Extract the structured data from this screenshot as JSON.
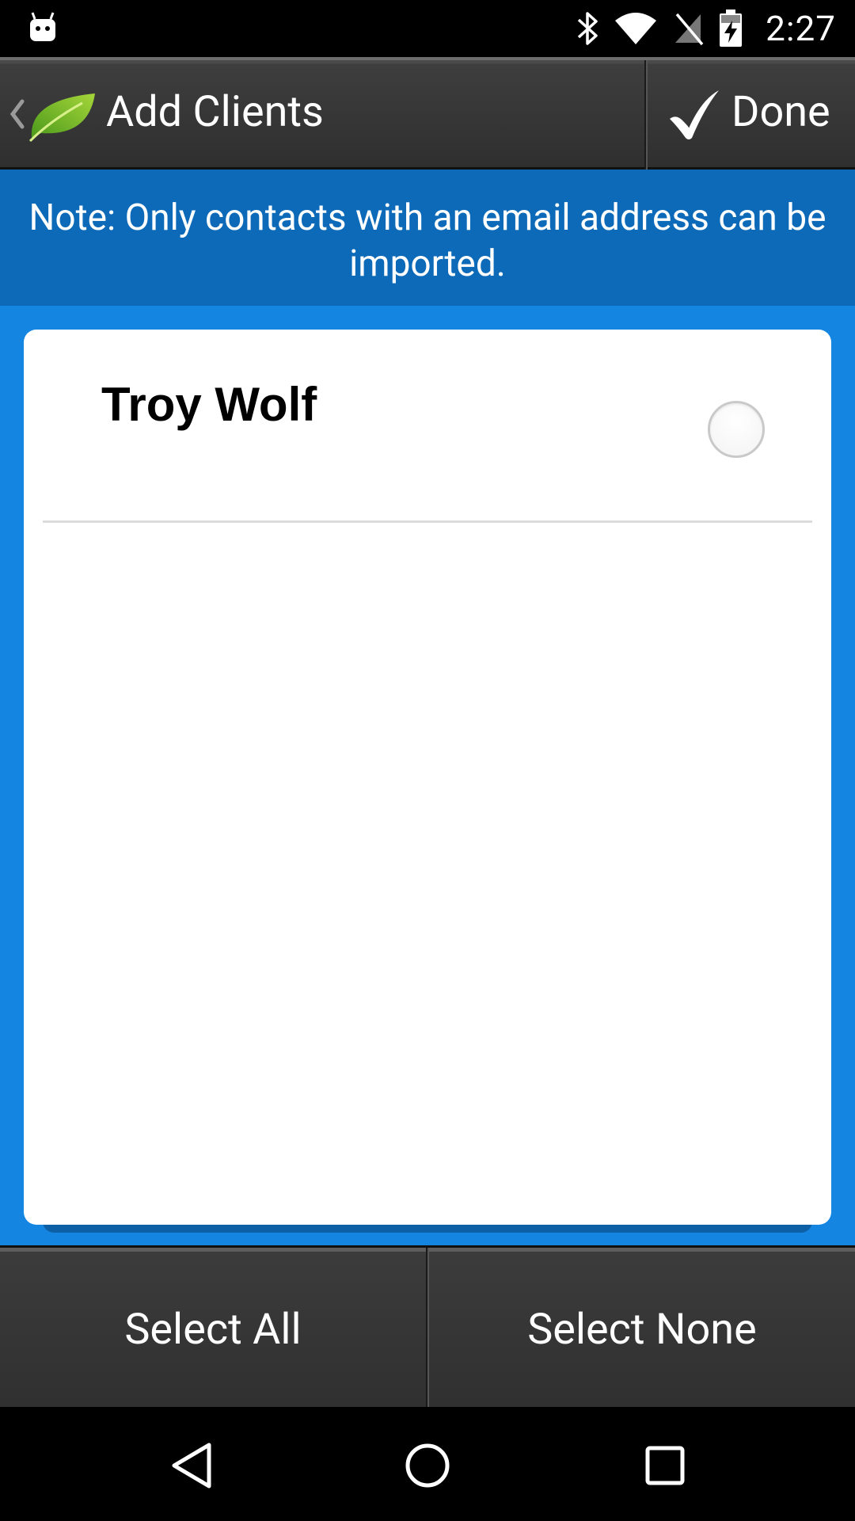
{
  "status_bar": {
    "time": "2:27",
    "icons": [
      "android-debug-icon",
      "bluetooth-icon",
      "wifi-icon",
      "no-sim-icon",
      "battery-charging-icon"
    ]
  },
  "action_bar": {
    "title": "Add Clients",
    "done_label": "Done",
    "icons": [
      "chevron-left-icon",
      "leaf-logo-icon",
      "checkmark-icon"
    ]
  },
  "note": {
    "text": "Note: Only contacts with an email address can be imported."
  },
  "contacts": [
    {
      "name": "Troy Wolf",
      "selected": false
    }
  ],
  "bottom_bar": {
    "select_all_label": "Select All",
    "select_none_label": "Select None"
  },
  "nav_bar": {
    "icons": [
      "back-icon",
      "home-icon",
      "recents-icon"
    ]
  }
}
